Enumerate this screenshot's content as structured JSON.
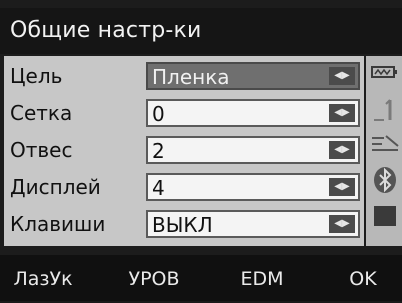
{
  "window": {
    "title": "Общие настр-ки"
  },
  "settings": [
    {
      "label": "Цель",
      "value": "Пленка"
    },
    {
      "label": "Сетка",
      "value": "0"
    },
    {
      "label": "Отвес",
      "value": "2"
    },
    {
      "label": "Дисплей",
      "value": "4"
    },
    {
      "label": "Клавиши",
      "value": "ВЫКЛ"
    }
  ],
  "sidebar": {
    "icons": [
      "battery-icon",
      "target-constant-icon",
      "measure-mode-icon",
      "bluetooth-icon",
      "memory-icon"
    ]
  },
  "softkeys": [
    {
      "label": "ЛазУк"
    },
    {
      "label": "УРОВ"
    },
    {
      "label": "EDM"
    },
    {
      "label": "OK"
    }
  ]
}
